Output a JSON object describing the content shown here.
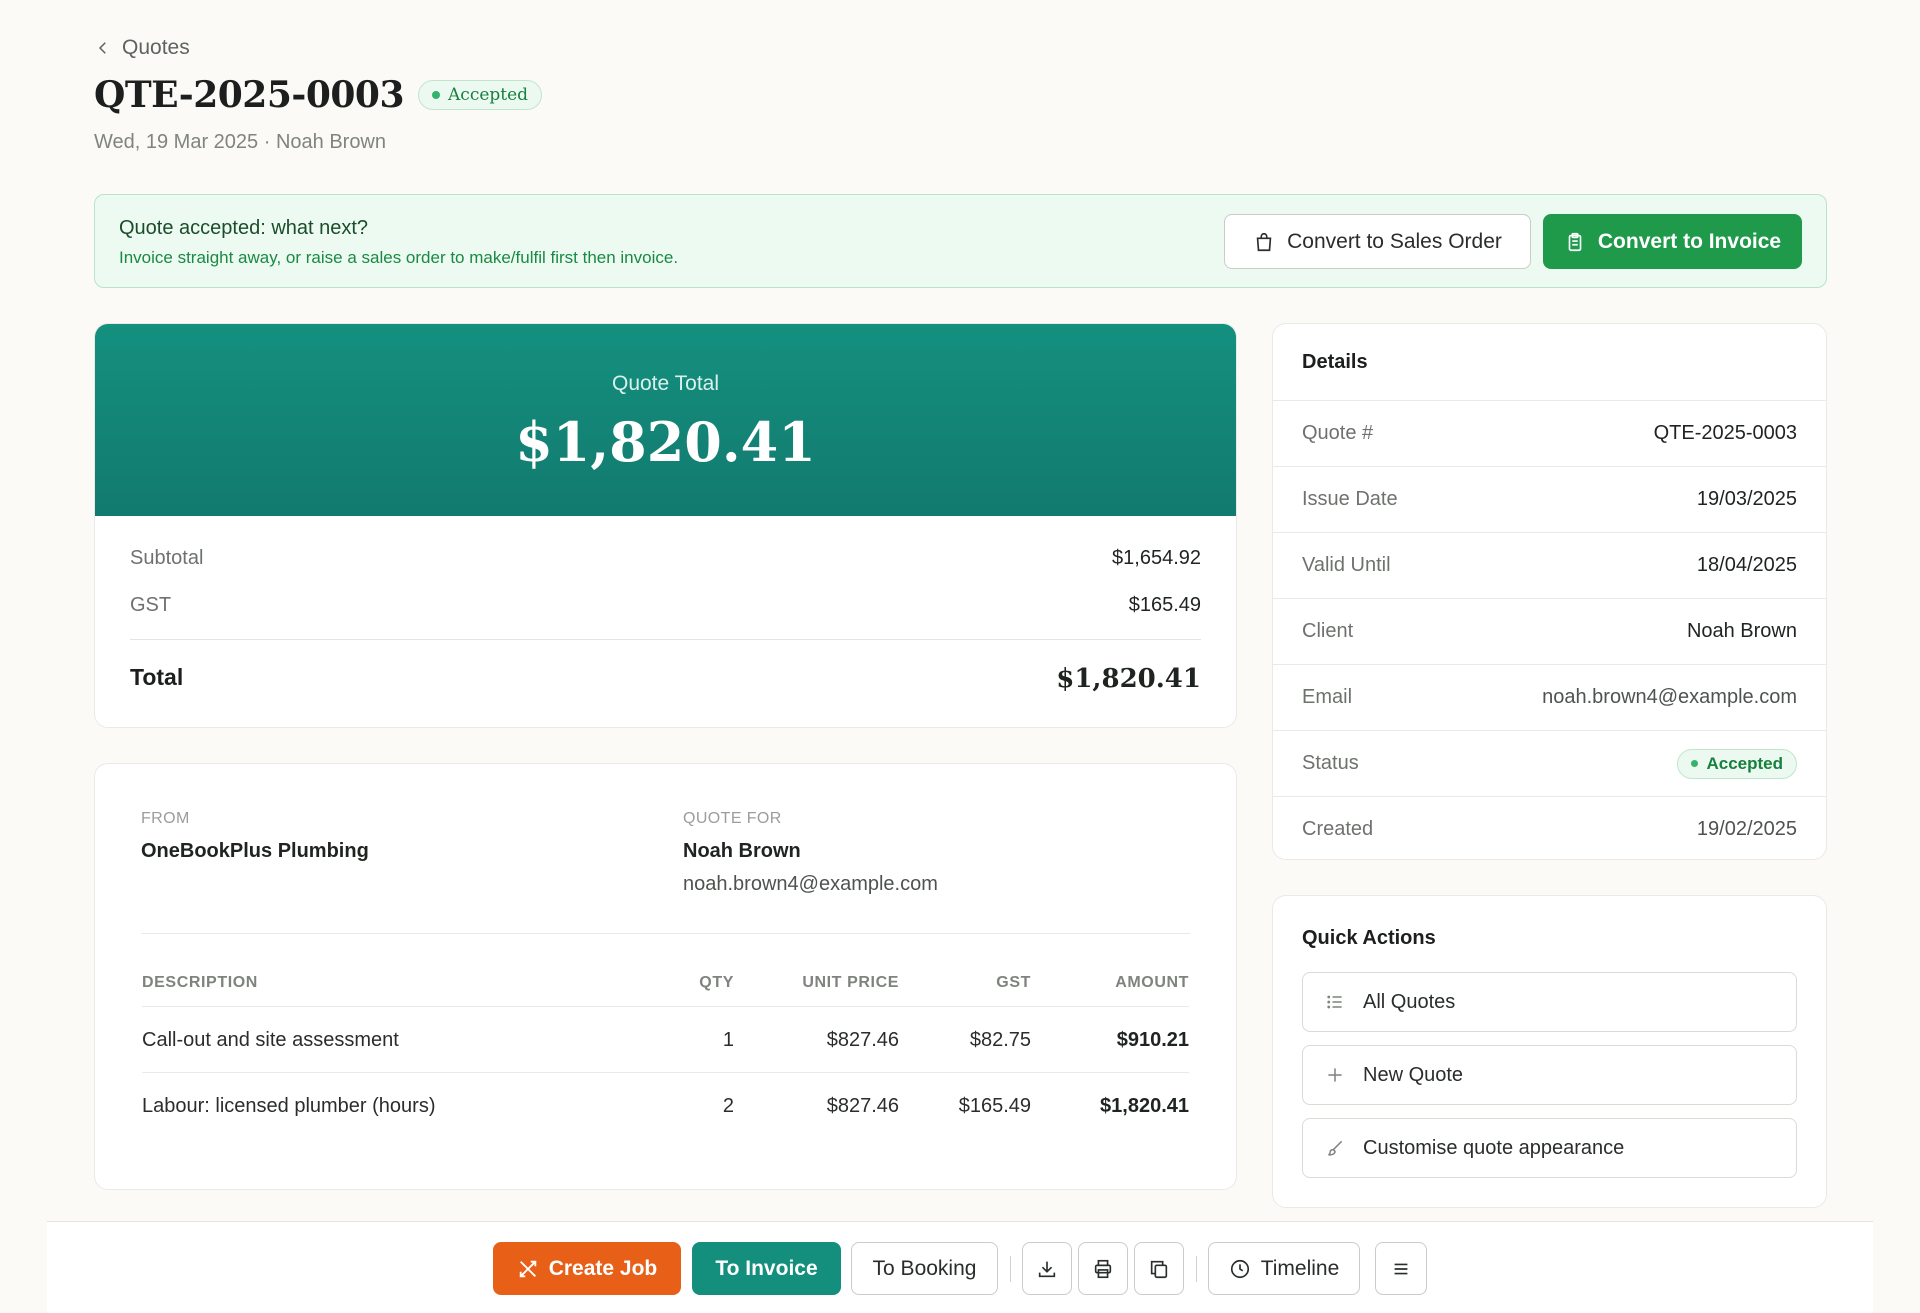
{
  "header": {
    "back_label": "Quotes",
    "title": "QTE-2025-0003",
    "status_badge": "Accepted",
    "subtitle": "Wed, 19 Mar 2025 · Noah Brown"
  },
  "banner": {
    "title": "Quote accepted: what next?",
    "text": "Invoice straight away, or raise a sales order to make/fulfil first then invoice.",
    "convert_sales_order_label": "Convert to Sales Order",
    "convert_invoice_label": "Convert to Invoice"
  },
  "totals": {
    "hero_label": "Quote Total",
    "hero_amount": "$1,820.41",
    "subtotal_label": "Subtotal",
    "subtotal_value": "$1,654.92",
    "gst_label": "GST",
    "gst_value": "$165.49",
    "total_label": "Total",
    "total_value": "$1,820.41"
  },
  "document": {
    "from_label": "FROM",
    "from_name": "OneBookPlus Plumbing",
    "for_label": "QUOTE FOR",
    "for_name": "Noah Brown",
    "for_email": "noah.brown4@example.com",
    "columns": [
      "DESCRIPTION",
      "QTY",
      "UNIT PRICE",
      "GST",
      "AMOUNT"
    ],
    "rows": [
      [
        "Call-out and site assessment",
        "1",
        "$827.46",
        "$82.75",
        "$910.21"
      ],
      [
        "Labour: licensed plumber (hours)",
        "2",
        "$827.46",
        "$165.49",
        "$1,820.41"
      ]
    ]
  },
  "details": {
    "title": "Details",
    "rows": [
      {
        "label": "Quote #",
        "value": "QTE-2025-0003"
      },
      {
        "label": "Issue Date",
        "value": "19/03/2025"
      },
      {
        "label": "Valid Until",
        "value": "18/04/2025"
      },
      {
        "label": "Client",
        "value": "Noah Brown"
      },
      {
        "label": "Email",
        "value": "noah.brown4@example.com"
      },
      {
        "label": "Status",
        "value": "Accepted"
      },
      {
        "label": "Created",
        "value": "19/02/2025"
      }
    ]
  },
  "quick_actions": {
    "title": "Quick Actions",
    "items": [
      {
        "label": "All Quotes",
        "icon": "list-icon"
      },
      {
        "label": "New Quote",
        "icon": "plus-icon"
      },
      {
        "label": "Customise quote appearance",
        "icon": "brush-icon"
      }
    ]
  },
  "bottom_bar": {
    "create_job": "Create Job",
    "to_invoice": "To Invoice",
    "to_booking": "To Booking",
    "timeline": "Timeline"
  },
  "colors": {
    "teal": "#158f7d",
    "green": "#1f9a4b",
    "orange": "#e85f18",
    "accepted": "#17803d"
  }
}
